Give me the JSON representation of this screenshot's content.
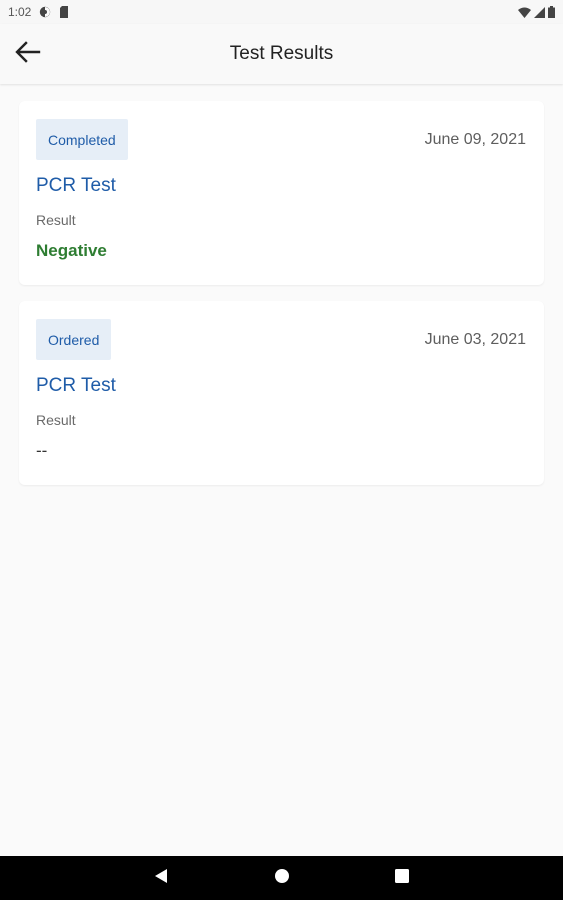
{
  "status_bar": {
    "time": "1:02"
  },
  "app_bar": {
    "title": "Test Results"
  },
  "tests": [
    {
      "status": "Completed",
      "date": "June 09, 2021",
      "name": "PCR Test",
      "result_label": "Result",
      "result_value": "Negative"
    },
    {
      "status": "Ordered",
      "date": "June 03, 2021",
      "name": "PCR Test",
      "result_label": "Result",
      "result_value": "--"
    }
  ],
  "colors": {
    "accent": "#1f5ca8",
    "chip_bg": "#e6eef7",
    "negative": "#2e7d32"
  },
  "icons": {
    "back": "arrow-left-icon",
    "wifi": "wifi-icon",
    "signal": "cell-signal-icon",
    "battery": "battery-icon",
    "nav_back": "triangle-back-icon",
    "nav_home": "circle-home-icon",
    "nav_recents": "square-recents-icon"
  }
}
